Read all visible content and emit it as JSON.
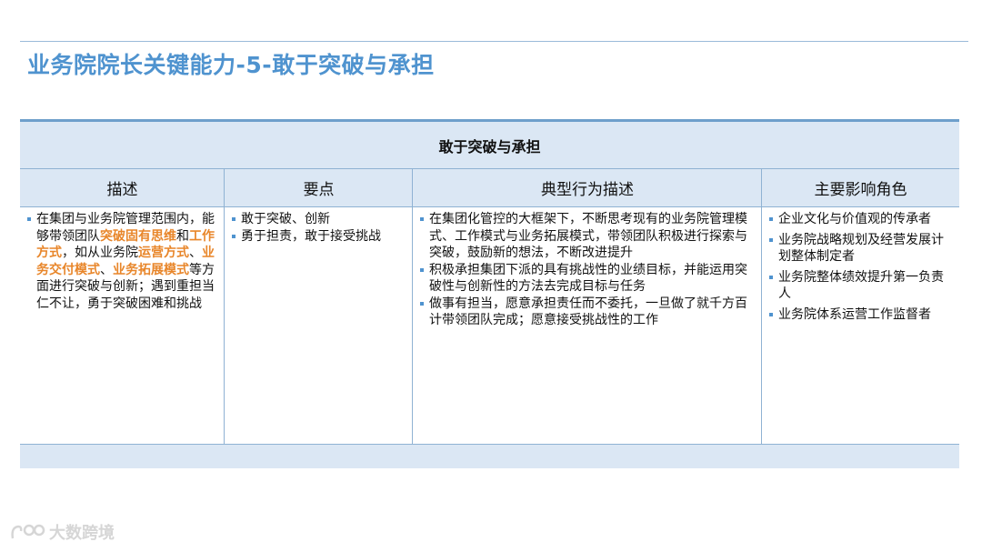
{
  "slide": {
    "title": "业务院院长关键能力-5-敢于突破与承担"
  },
  "table": {
    "caption": "敢于突破与承担",
    "headers": [
      "描述",
      "要点",
      "典型行为描述",
      "主要影响角色"
    ],
    "description": {
      "segments": [
        {
          "text": "在集团与业务院管理范围内，能够带领团队",
          "highlight": false
        },
        {
          "text": "突破固有思维",
          "highlight": true
        },
        {
          "text": "和",
          "highlight": false
        },
        {
          "text": "工作方式",
          "highlight": true
        },
        {
          "text": "，如从业务院",
          "highlight": false
        },
        {
          "text": "运营方式",
          "highlight": true
        },
        {
          "text": "、",
          "highlight": false
        },
        {
          "text": "业务交付模式",
          "highlight": true
        },
        {
          "text": "、",
          "highlight": false
        },
        {
          "text": "业务拓展模式",
          "highlight": true
        },
        {
          "text": "等方面进行突破与创新；遇到重担当仁不让，勇于突破困难和挑战",
          "highlight": false
        }
      ]
    },
    "key_points": [
      "敢于突破、创新",
      "勇于担责，敢于接受挑战"
    ],
    "behaviors": [
      "在集团化管控的大框架下，不断思考现有的业务院管理模式、工作模式与业务拓展模式，带领团队积极进行探索与突破，鼓励新的想法，不断改进提升",
      "积极承担集团下派的具有挑战性的业绩目标，并能运用突破性与创新性的方法去完成目标与任务",
      "做事有担当，愿意承担责任而不委托，一旦做了就千方百计带领团队完成；愿意接受挑战性的工作"
    ],
    "roles": [
      "企业文化与价值观的传承者",
      "业务院战略规划及经营发展计划整体制定者",
      "业务院整体绩效提升第一负责人",
      "业务院体系运营工作监督者"
    ]
  },
  "watermark": {
    "text": "大数跨境"
  },
  "colors": {
    "title": "#4f93cf",
    "header_bg": "#dbe7f4",
    "border": "#8fb2d3",
    "highlight": "#e8862a"
  }
}
